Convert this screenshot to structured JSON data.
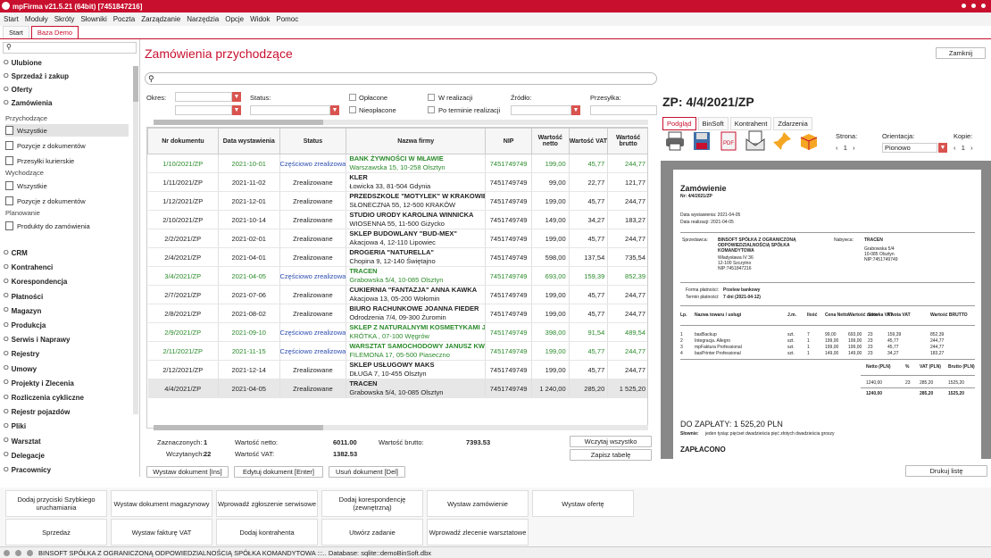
{
  "window": {
    "title": "mpFirma v21.5.21 (64bit) [7451847216]"
  },
  "menu": [
    "Start",
    "Moduły",
    "Skróty",
    "Słowniki",
    "Poczta",
    "Zarządzanie",
    "Narzędzia",
    "Opcje",
    "Widok",
    "Pomoc"
  ],
  "tabs": [
    {
      "label": "Start"
    },
    {
      "label": "Baza Demo"
    }
  ],
  "sidebar": {
    "search_placeholder": "",
    "groups_top": [
      "Ulubione",
      "Sprzedaż i zakup",
      "Oferty",
      "Zamówienia"
    ],
    "sub_przych": "Przychodzące",
    "items_przych": [
      "Wszystkie",
      "Pozycje z dokumentów",
      "Przesyłki kurierskie"
    ],
    "sub_wych": "Wychodzące",
    "items_wych": [
      "Wszystkie",
      "Pozycje z dokumentów"
    ],
    "sub_plan": "Planowanie",
    "items_plan": [
      "Produkty do zamówienia"
    ],
    "groups_bottom": [
      "CRM",
      "Kontrahenci",
      "Korespondencja",
      "Płatności",
      "Magazyn",
      "Produkcja",
      "Serwis i Naprawy",
      "Rejestry",
      "Umowy",
      "Projekty i Zlecenia",
      "Rozliczenia cykliczne",
      "Rejestr pojazdów",
      "Pliki",
      "Warsztat",
      "Delegacje",
      "Pracownicy"
    ]
  },
  "main": {
    "title": "Zamówienia przychodzące",
    "close_label": "Zamknij",
    "filters": {
      "okres": "Okres:",
      "status": "Status:",
      "oplacone": "Opłacone",
      "nieoplacone": "Nieopłacone",
      "w_realizacji": "W realizacji",
      "po_terminie": "Po terminie realizacji",
      "zrodlo": "Źródło:",
      "przesylka": "Przesyłka:"
    },
    "columns": [
      "Nr dokumentu",
      "Data wystawienia",
      "Status",
      "Nazwa firmy",
      "NIP",
      "Wartość netto",
      "Wartość VAT",
      "Wartość brutto"
    ],
    "rows": [
      {
        "nr": "1/10/2021/ZP",
        "data": "2021-10-01",
        "status": "Częściowo zrealizowane",
        "firma": "BANK ŻYWNOŚCI W MŁAWIE",
        "adres": "Warszawska 15, 10-258 Olsztyn",
        "nip": "7451749749",
        "netto": "199,00",
        "vat": "45,77",
        "brutto": "244,77",
        "style": "green"
      },
      {
        "nr": "1/11/2021/ZP",
        "data": "2021-11-02",
        "status": "Zrealizowane",
        "firma": "KLER",
        "adres": "Łowicka 33, 81-504 Gdynia",
        "nip": "7451749749",
        "netto": "99,00",
        "vat": "22,77",
        "brutto": "121,77",
        "style": ""
      },
      {
        "nr": "1/12/2021/ZP",
        "data": "2021-12-01",
        "status": "Zrealizowane",
        "firma": "PRZEDSZKOLE \"MOTYLEK\" W KRAKOWIE",
        "adres": "SŁONECZNA 55, 12-500 KRAKÓW",
        "nip": "7451749749",
        "netto": "199,00",
        "vat": "45,77",
        "brutto": "244,77",
        "style": ""
      },
      {
        "nr": "2/10/2021/ZP",
        "data": "2021-10-14",
        "status": "Zrealizowane",
        "firma": "STUDIO URODY KAROLINA WINNICKA",
        "adres": "WIOSENNA 55, 11-500 Giżycko",
        "nip": "7451749749",
        "netto": "149,00",
        "vat": "34,27",
        "brutto": "183,27",
        "style": ""
      },
      {
        "nr": "2/2/2021/ZP",
        "data": "2021-02-01",
        "status": "Zrealizowane",
        "firma": "SKLEP BUDOWLANY \"BUD-MEX\"",
        "adres": "Akacjowa 4, 12-110 Lipowiec",
        "nip": "7451749749",
        "netto": "199,00",
        "vat": "45,77",
        "brutto": "244,77",
        "style": ""
      },
      {
        "nr": "2/4/2021/ZP",
        "data": "2021-04-01",
        "status": "Zrealizowane",
        "firma": "DROGERIA \"NATURELLA\"",
        "adres": "Chopina 9, 12-140 Świętajno",
        "nip": "7451749749",
        "netto": "598,00",
        "vat": "137,54",
        "brutto": "735,54",
        "style": ""
      },
      {
        "nr": "3/4/2021/ZP",
        "data": "2021-04-05",
        "status": "Częściowo zrealizowane",
        "firma": "TRACEN",
        "adres": "Grabowska 5/4, 10-085 Olsztyn",
        "nip": "7451749749",
        "netto": "693,00",
        "vat": "159,39",
        "brutto": "852,39",
        "style": "green"
      },
      {
        "nr": "2/7/2021/ZP",
        "data": "2021-07-06",
        "status": "Zrealizowane",
        "firma": "CUKIERNIA \"FANTAZJA\" ANNA KAWKA",
        "adres": "Akacjowa 13, 05-200 Wołomin",
        "nip": "7451749749",
        "netto": "199,00",
        "vat": "45,77",
        "brutto": "244,77",
        "style": ""
      },
      {
        "nr": "2/8/2021/ZP",
        "data": "2021-08-02",
        "status": "Zrealizowane",
        "firma": "BIURO RACHUNKOWE JOANNA FIEDER",
        "adres": "Odrodzenia 7/4, 09-300 Żuromin",
        "nip": "7451749749",
        "netto": "199,00",
        "vat": "45,77",
        "brutto": "244,77",
        "style": ""
      },
      {
        "nr": "2/9/2021/ZP",
        "data": "2021-09-10",
        "status": "Częściowo zrealizowane",
        "firma": "SKLEP Z NATURALNYMI KOSMETYKAMI JAI",
        "adres": "KRÓTKA , 07-100 Węgrów",
        "nip": "7451749749",
        "netto": "398,00",
        "vat": "91,54",
        "brutto": "489,54",
        "style": "green"
      },
      {
        "nr": "2/11/2021/ZP",
        "data": "2021-11-15",
        "status": "Częściowo zrealizowane",
        "firma": "WARSZTAT SAMOCHODOWY JANUSZ KWA",
        "adres": "FILEMONA 17, 05-500 Piaseczno",
        "nip": "7451749749",
        "netto": "199,00",
        "vat": "45,77",
        "brutto": "244,77",
        "style": "green"
      },
      {
        "nr": "2/12/2021/ZP",
        "data": "2021-12-14",
        "status": "Zrealizowane",
        "firma": "SKLEP USŁUGOWY MAKS",
        "adres": "DŁUGA 7, 10-455 Olsztyn",
        "nip": "7451749749",
        "netto": "199,00",
        "vat": "45,77",
        "brutto": "244,77",
        "style": ""
      },
      {
        "nr": "4/4/2021/ZP",
        "data": "2021-04-05",
        "status": "Zrealizowane",
        "firma": "TRACEN",
        "adres": "Grabowska 5/4, 10-085 Olsztyn",
        "nip": "7451749749",
        "netto": "1 240,00",
        "vat": "285,20",
        "brutto": "1 525,20",
        "style": "sel"
      }
    ],
    "summary": {
      "zaznaczonych_l": "Zaznaczonych:",
      "zaznaczonych": "1",
      "wczytanych_l": "Wczytanych:",
      "wczytanych": "22",
      "netto_l": "Wartość netto:",
      "netto": "6011.00",
      "vat_l": "Wartość VAT:",
      "vat": "1382.53",
      "brutto_l": "Wartość brutto:",
      "brutto": "7393.53"
    },
    "wczytaj": "Wczytaj wszystko",
    "zapisz": "Zapisz tabelę",
    "actions": [
      "Wystaw dokument [Ins]",
      "Edytuj dokument [Enter]",
      "Usuń dokument [Del]"
    ]
  },
  "right": {
    "title": "ZP: 4/4/2021/ZP",
    "tabs": [
      "Podgląd",
      "BinSoft",
      "Kontrahent",
      "Zdarzenia"
    ],
    "strona_l": "Strona:",
    "strona": "1",
    "orient_l": "Orientacja:",
    "orient": "Pionowo",
    "kopie_l": "Kopie:",
    "kopie": "1",
    "pdf": "PDF",
    "drukuj": "Drukuj listę",
    "doc": {
      "title": "Zamówienie",
      "nr": "Nr: 4/4/2021/ZP",
      "data_w": "Data wystawienia: 2021-04-05",
      "data_r": "Data realizacji: 2021-04-05",
      "sprzedawca_l": "Sprzedawca:",
      "sprzedawca": "BINSOFT SPÓŁKA Z OGRANICZONĄ",
      "sprzedawca2": "ODPOWIEDZIALNOŚCIĄ SPÓŁKA",
      "sprzedawca3": "KOMANDYTOWA",
      "s_addr1": "Władysława IV 36",
      "s_addr2": "12-100 Szczytno",
      "s_nip": "NIP:7451847216",
      "nabywca_l": "Nabywca:",
      "nabywca": "TRACEN",
      "n_addr1": "Grabowska 5/4",
      "n_addr2": "10-085 Olsztyn",
      "n_nip": "NIP:7451749749",
      "forma_l": "Forma płatności:",
      "forma": "Przelew bankowy",
      "termin_l": "Termin płatności:",
      "termin": "7 dni (2021-04-12)",
      "cols": [
        "Lp.",
        "Nazwa towaru / usługi",
        "J.m.",
        "Ilość",
        "Cena Netto",
        "Wartość netto",
        "Stawka VAT",
        "Kwota VAT",
        "Wartość BRUTTO"
      ],
      "items": [
        [
          "1",
          "basBackup",
          "szt.",
          "7",
          "99,00",
          "693,00",
          "23",
          "159,39",
          "852,39"
        ],
        [
          "2",
          "Integracja. Allegro",
          "szt.",
          "1",
          "199,00",
          "199,00",
          "23",
          "45,77",
          "244,77"
        ],
        [
          "3",
          "mpFaktura Professional",
          "szt.",
          "1",
          "199,00",
          "199,00",
          "23",
          "45,77",
          "244,77"
        ],
        [
          "4",
          "basPrinter Professional",
          "szt.",
          "1",
          "149,00",
          "149,00",
          "23",
          "34,27",
          "183,27"
        ]
      ],
      "sum_cols": [
        "Netto (PLN)",
        "%",
        "VAT (PLN)",
        "Brutto (PLN)"
      ],
      "sum1": [
        "1240,00",
        "23",
        "285,20",
        "1525,20"
      ],
      "sum2": [
        "1240,00",
        "",
        "285,20",
        "1525,20"
      ],
      "dozaplaty": "DO ZAPŁATY: 1 525,20 PLN",
      "slownie_l": "Słownie:",
      "slownie": "jeden tysiąc pięćset dwadzieścia pięć złotych dwadzieścia groszy",
      "zaplacono": "ZAPŁACONO"
    }
  },
  "grid_buttons": [
    [
      "Dodaj przyciski Szybkiego uruchamiania",
      "Wystaw dokument magazynowy",
      "Wprowadź zgłoszenie serwisowe",
      "Dodaj korespondencję (zewnętrzną)",
      "Wystaw zamówienie",
      "Wystaw ofertę"
    ],
    [
      "Sprzedaż",
      "Wystaw fakturę VAT",
      "Dodaj kontrahenta",
      "Utwórz zadanie",
      "Wprowadź zlecenie warsztatowe"
    ]
  ],
  "status": {
    "text": "BINSOFT SPÓŁKA Z OGRANICZONĄ ODPOWIEDZIALNOŚCIĄ SPÓŁKA KOMANDYTOWA :::.. Database: sqlite::demoBinSoft.dbx"
  }
}
